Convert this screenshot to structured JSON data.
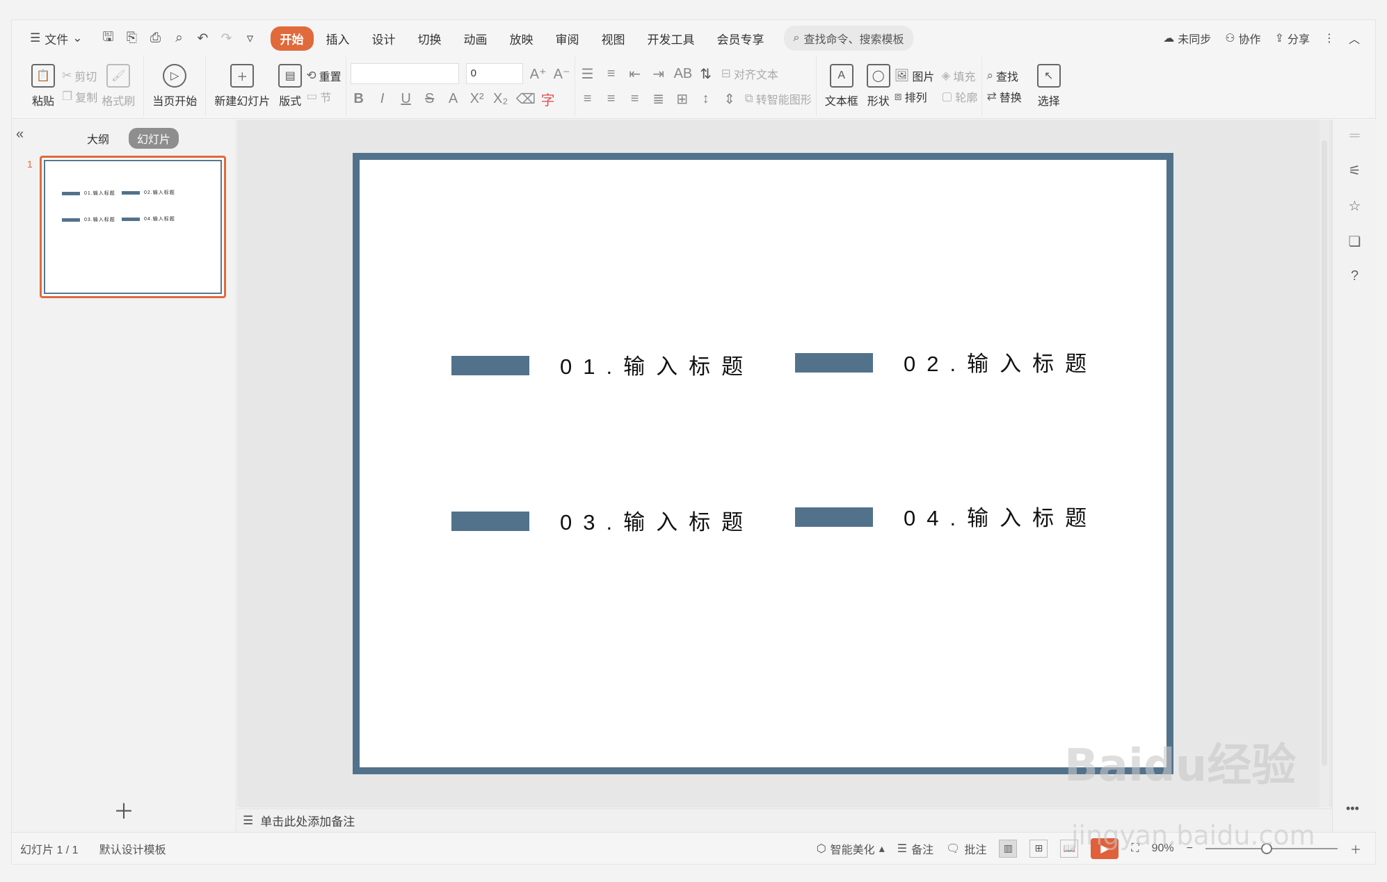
{
  "menubar": {
    "file": "文件",
    "tabs": [
      "开始",
      "插入",
      "设计",
      "切换",
      "动画",
      "放映",
      "审阅",
      "视图",
      "开发工具",
      "会员专享"
    ],
    "active_tab": "开始",
    "search_placeholder": "查找命令、搜索模板",
    "sync": "未同步",
    "collab": "协作",
    "share": "分享"
  },
  "ribbon": {
    "paste": "粘贴",
    "cut": "剪切",
    "copy": "复制",
    "format_painter": "格式刷",
    "play_current": "当页开始",
    "new_slide": "新建幻灯片",
    "layout": "版式",
    "reset": "重置",
    "section": "节",
    "font_size": "0",
    "align_text": "对齐文本",
    "smart_art": "转智能图形",
    "textbox": "文本框",
    "shape": "形状",
    "picture": "图片",
    "arrange": "排列",
    "fill": "填充",
    "outline": "轮廓",
    "find": "查找",
    "replace": "替换",
    "select": "选择"
  },
  "leftpanel": {
    "tab_outline": "大纲",
    "tab_slides": "幻灯片",
    "slide_number": "1"
  },
  "slide": {
    "items": [
      {
        "label": "01.输入标题"
      },
      {
        "label": "02.输入标题"
      },
      {
        "label": "03.输入标题"
      },
      {
        "label": "04.输入标题"
      }
    ],
    "accent_color": "#52728c"
  },
  "notes": {
    "placeholder": "单击此处添加备注"
  },
  "statusbar": {
    "slide_count": "幻灯片 1 / 1",
    "template": "默认设计模板",
    "beautify": "智能美化",
    "notes": "备注",
    "comments": "批注",
    "zoom": "90%"
  },
  "watermark": {
    "main": "Baidu经验",
    "sub": "jingyan.baidu.com"
  }
}
